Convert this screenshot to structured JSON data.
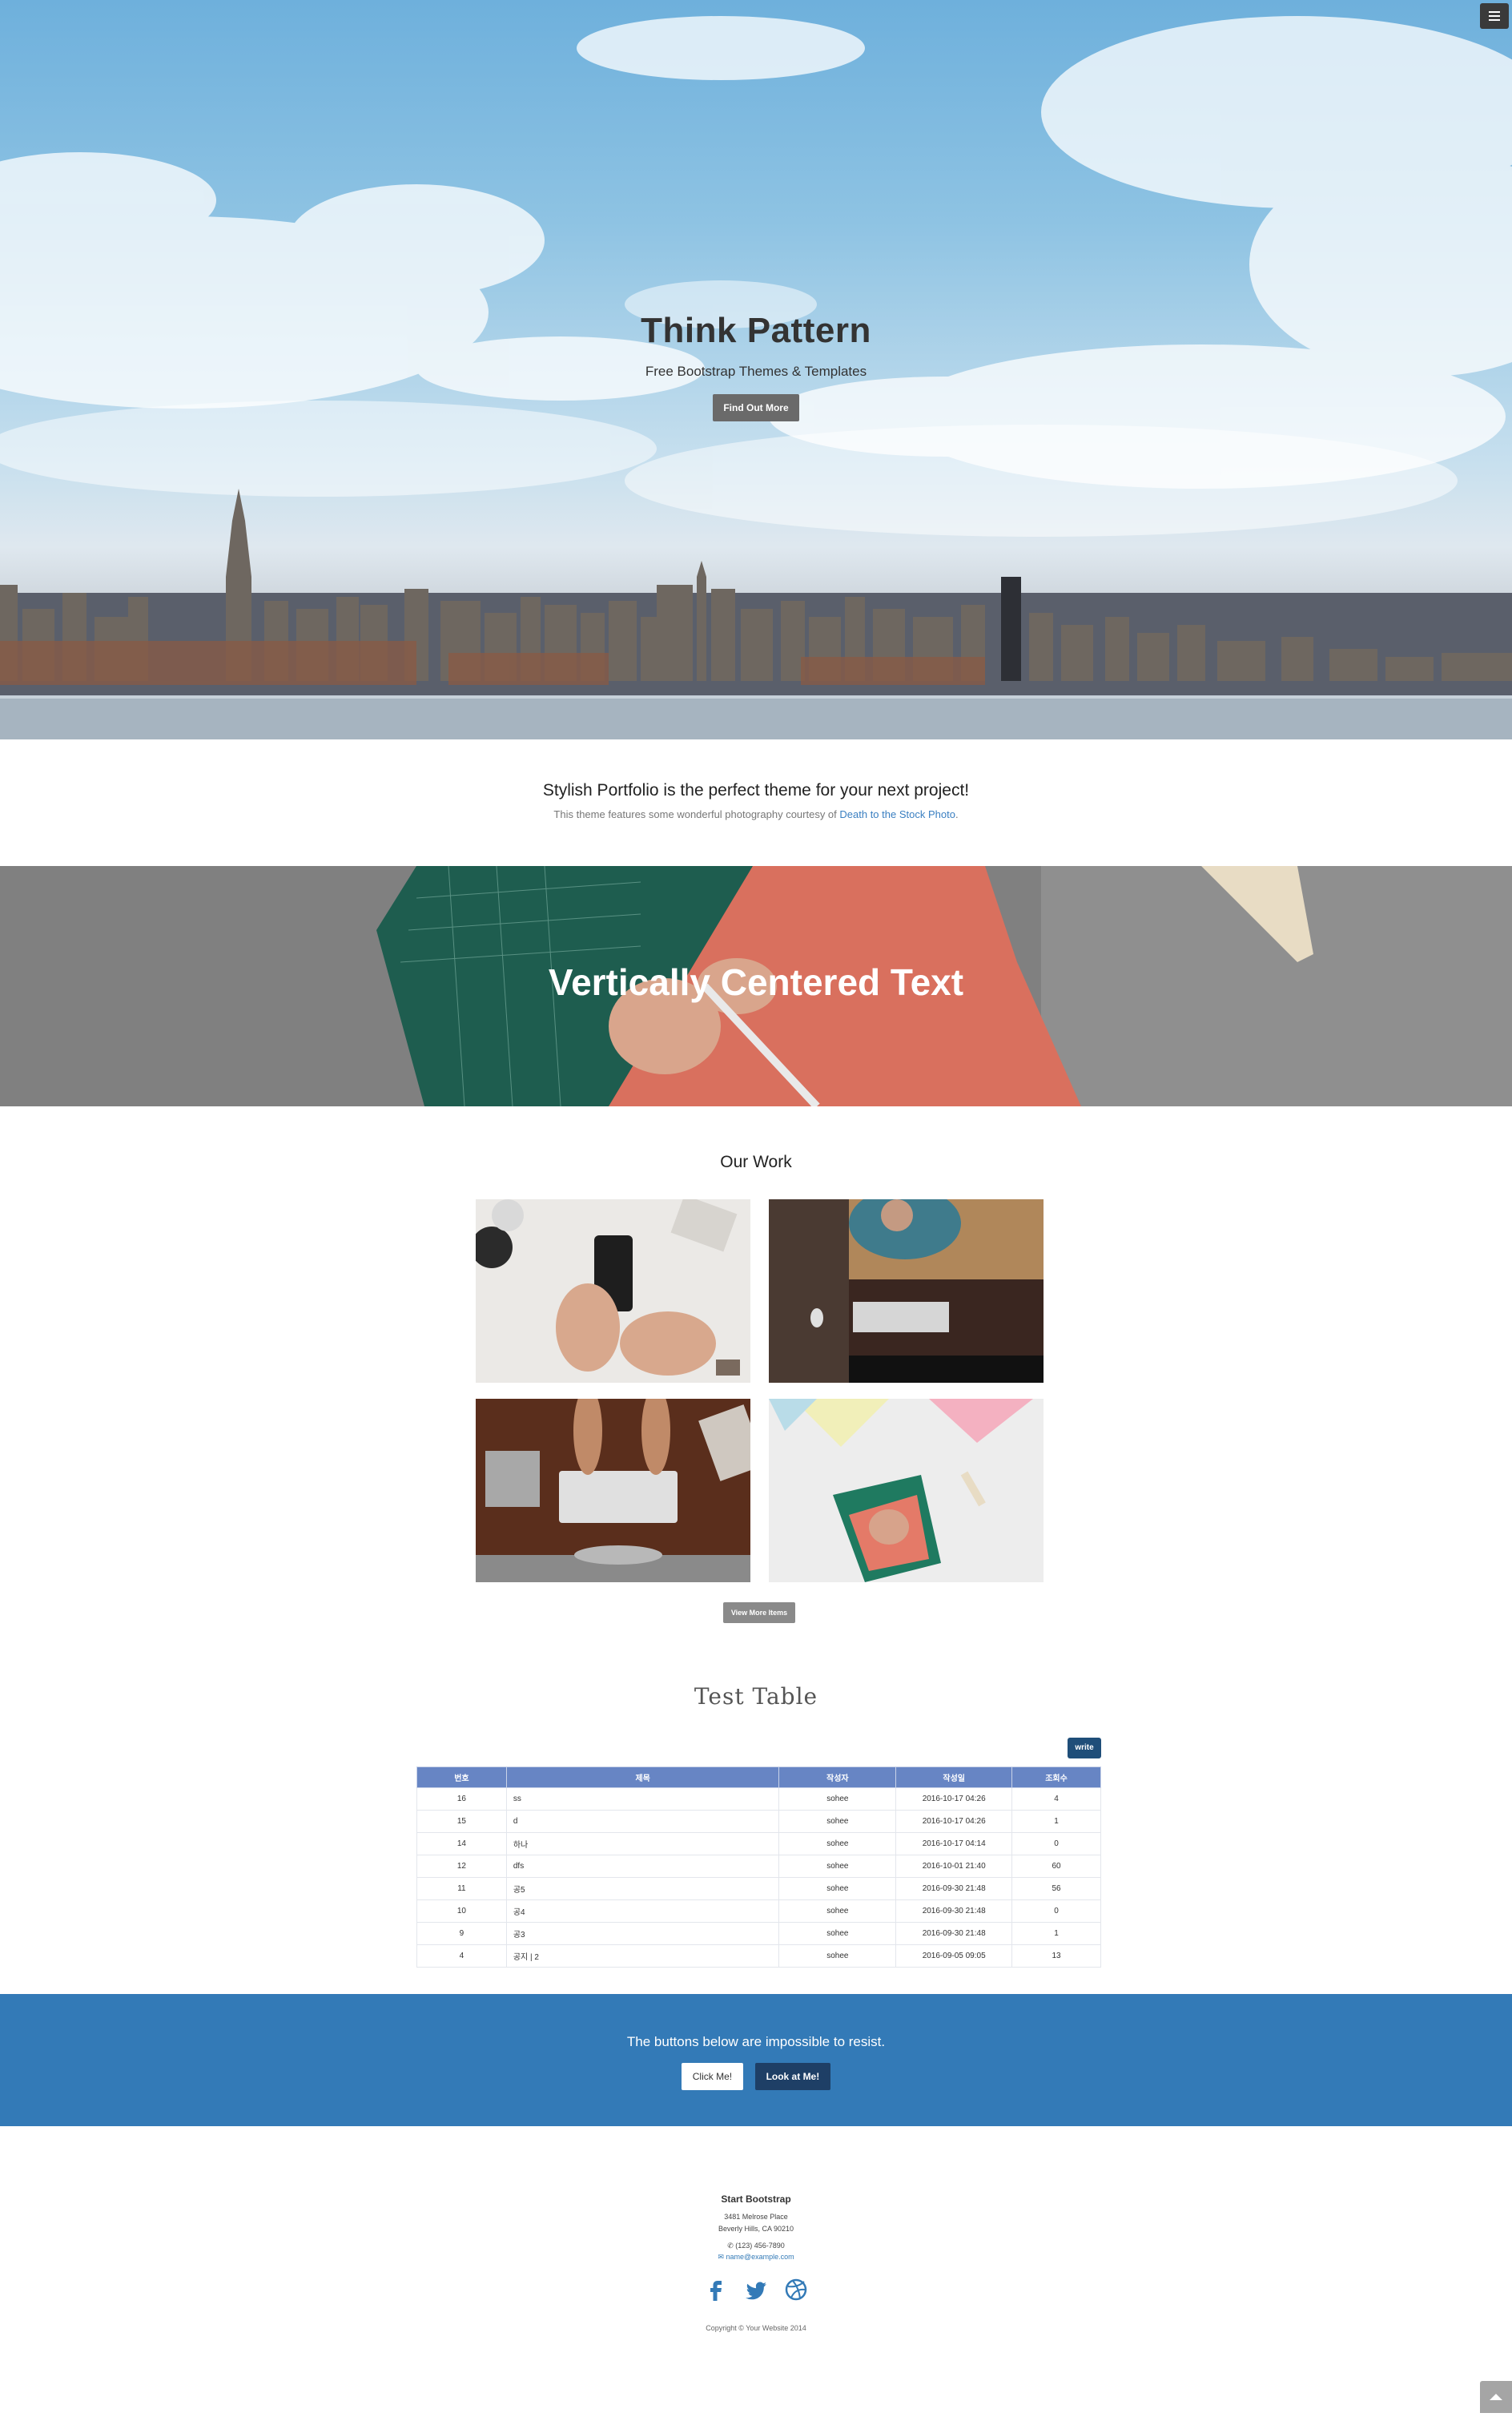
{
  "hero": {
    "title": "Think Pattern",
    "subtitle": "Free Bootstrap Themes & Templates",
    "button": "Find Out More"
  },
  "about": {
    "heading": "Stylish Portfolio is the perfect theme for your next project!",
    "text_prefix": "This theme features some wonderful photography courtesy of ",
    "link": "Death to the Stock Photo",
    "text_suffix": "."
  },
  "callout": {
    "text": "Vertically Centered Text"
  },
  "portfolio": {
    "heading": "Our Work",
    "button": "View More Items"
  },
  "table": {
    "title": "Test Table",
    "write_button": "write",
    "headers": [
      "번호",
      "제목",
      "작성자",
      "작성일",
      "조회수"
    ],
    "rows": [
      [
        "16",
        "ss",
        "sohee",
        "2016-10-17 04:26",
        "4"
      ],
      [
        "15",
        "d",
        "sohee",
        "2016-10-17 04:26",
        "1"
      ],
      [
        "14",
        "하나",
        "sohee",
        "2016-10-17 04:14",
        "0"
      ],
      [
        "12",
        "dfs",
        "sohee",
        "2016-10-01 21:40",
        "60"
      ],
      [
        "11",
        "공5",
        "sohee",
        "2016-09-30 21:48",
        "56"
      ],
      [
        "10",
        "공4",
        "sohee",
        "2016-09-30 21:48",
        "0"
      ],
      [
        "9",
        "공3",
        "sohee",
        "2016-09-30 21:48",
        "1"
      ],
      [
        "4",
        "공지 | 2",
        "sohee",
        "2016-09-05 09:05",
        "13"
      ]
    ]
  },
  "cta": {
    "text": "The buttons below are impossible to resist.",
    "button1": "Click Me!",
    "button2": "Look at Me!"
  },
  "footer": {
    "brand": "Start Bootstrap",
    "address1": "3481 Melrose Place",
    "address2": "Beverly Hills, CA 90210",
    "phone": "(123) 456-7890",
    "email": "name@example.com",
    "copyright": "Copyright © Your Website 2014",
    "social_icons": [
      "facebook-icon",
      "twitter-icon",
      "dribbble-icon"
    ]
  },
  "colors": {
    "cta_blue": "#337ab7",
    "table_header": "#6785c4",
    "write_button": "#1f4e79"
  }
}
